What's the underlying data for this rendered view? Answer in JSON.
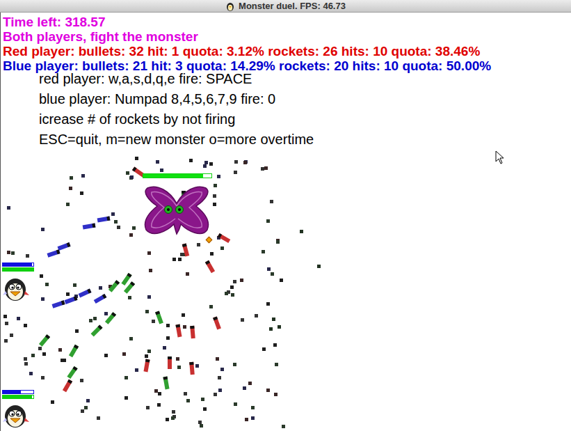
{
  "window": {
    "title": "Monster duel. FPS: 46.73"
  },
  "hud": {
    "time": "Time left: 318.57",
    "message": "Both players, fight the monster",
    "stats": [
      {
        "text": "Red player: bullets: 32 hit: 1 quota: 3.12% rockets: 26 hits: 10 quota: 38.46%",
        "color": "#e00000"
      },
      {
        "text": "Blue player: bullets: 21 hit: 3 quota: 14.29% rockets: 20 hits: 10 quota: 50.00%",
        "color": "#0000d0"
      }
    ]
  },
  "help": [
    "red player:  w,a,s,d,q,e fire: SPACE",
    "blue player: Numpad 8,4,5,6,7,9 fire: 0",
    "icrease # of rockets by not firing",
    "ESC=quit, m=new monster o=more overtime"
  ],
  "monster": {
    "health": 0.88
  },
  "players": [
    {
      "bars": [
        {
          "level": 0.95,
          "color": "#1010e0"
        },
        {
          "level": 1.0,
          "color": "#10d010"
        }
      ]
    },
    {
      "bars": [
        {
          "level": 0.6,
          "color": "#1010e0"
        },
        {
          "level": 0.96,
          "color": "#10d010"
        }
      ]
    }
  ],
  "rockets": [
    {
      "color": "#c83030"
    },
    {
      "color": "#c83030"
    },
    {
      "color": "#c83030"
    },
    {
      "color": "#c83030"
    },
    {
      "color": "#c83030"
    },
    {
      "color": "#c83030"
    },
    {
      "color": "#c83030"
    },
    {
      "color": "#c83030"
    },
    {
      "color": "#c83030"
    },
    {
      "color": "#c83030"
    },
    {
      "color": "#c83030"
    },
    {
      "color": "#3030c8"
    },
    {
      "color": "#3030c8"
    },
    {
      "color": "#3030c8"
    },
    {
      "color": "#3030c8"
    },
    {
      "color": "#3030c8"
    },
    {
      "color": "#3030c8"
    },
    {
      "color": "#3030c8"
    },
    {
      "color": "#3030c8"
    },
    {
      "color": "#30a030"
    },
    {
      "color": "#30a030"
    },
    {
      "color": "#30a030"
    },
    {
      "color": "#30a030"
    },
    {
      "color": "#30a030"
    },
    {
      "color": "#30a030"
    },
    {
      "color": "#30a030"
    },
    {
      "color": "#30a030"
    },
    {
      "color": "#30a030"
    },
    {
      "color": "#30a030"
    },
    {
      "color": "#30a030"
    }
  ]
}
